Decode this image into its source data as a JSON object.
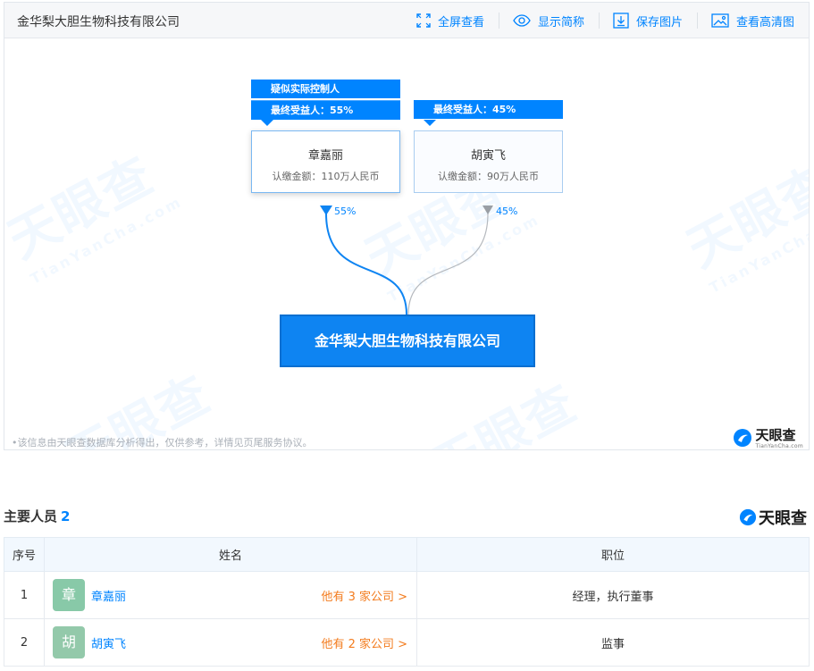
{
  "panel": {
    "title": "金华梨大胆生物科技有限公司",
    "toolbar": [
      {
        "label": "全屏查看",
        "icon": "fullscreen-icon"
      },
      {
        "label": "显示简称",
        "icon": "eye-icon"
      },
      {
        "label": "保存图片",
        "icon": "download-icon"
      },
      {
        "label": "查看高清图",
        "icon": "image-icon"
      }
    ]
  },
  "graph": {
    "watermark_text": "天眼查",
    "watermark_sub": "TianYanCha.com",
    "holders": [
      {
        "tag_top": "疑似实际控制人",
        "tag_bottom": "最终受益人：55%",
        "name": "章嘉丽",
        "capital": "认缴金额：110万人民币",
        "percent": "55%"
      },
      {
        "tag_bottom": "最终受益人：45%",
        "name": "胡寅飞",
        "capital": "认缴金额：90万人民币",
        "percent": "45%"
      }
    ],
    "company": "金华梨大胆生物科技有限公司",
    "disclaimer": "•该信息由天眼查数据库分析得出，仅供参考，详情见页尾服务协议。",
    "brand": "天眼查",
    "brand_sub": "TianYanCha.com"
  },
  "section": {
    "title": "主要人员",
    "count": "2",
    "brand": "天眼查"
  },
  "table": {
    "headers": [
      "序号",
      "姓名",
      "职位"
    ],
    "rows": [
      {
        "num": "1",
        "avatar": "章",
        "name": "章嘉丽",
        "companies": "他有 3 家公司 >",
        "position": "经理，执行董事"
      },
      {
        "num": "2",
        "avatar": "胡",
        "name": "胡寅飞",
        "companies": "他有 2 家公司 >",
        "position": "监事"
      }
    ]
  },
  "colors": {
    "accent": "#0084ff",
    "orange": "#f37b1d",
    "company_box": "#0e84f2"
  }
}
